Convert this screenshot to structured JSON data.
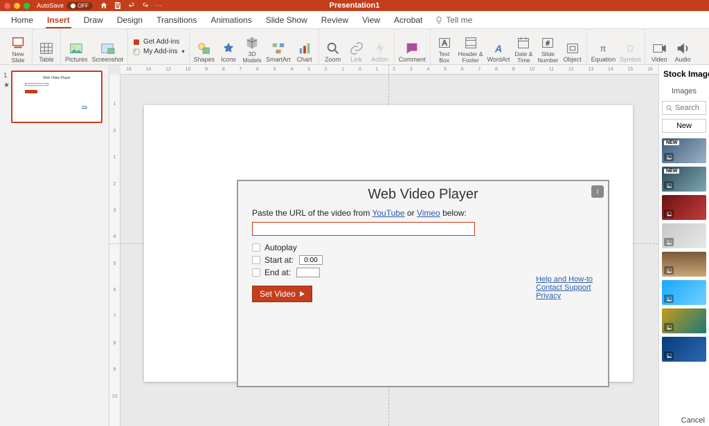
{
  "titlebar": {
    "autosave_label": "AutoSave",
    "autosave_state": "OFF",
    "doc_title": "Presentation1"
  },
  "tabs": {
    "items": [
      "Home",
      "Insert",
      "Draw",
      "Design",
      "Transitions",
      "Animations",
      "Slide Show",
      "Review",
      "View",
      "Acrobat"
    ],
    "active_index": 1,
    "tellme": "Tell me"
  },
  "ribbon": {
    "new_slide": "New\nSlide",
    "table": "Table",
    "pictures": "Pictures",
    "screenshot": "Screenshot",
    "get_addins": "Get Add-ins",
    "my_addins": "My Add-ins",
    "shapes": "Shapes",
    "icons": "Icons",
    "models": "3D\nModels",
    "smartart": "SmartArt",
    "chart": "Chart",
    "zoom": "Zoom",
    "link": "Link",
    "action": "Action",
    "comment": "Comment",
    "textbox": "Text\nBox",
    "header": "Header &\nFooter",
    "wordart": "WordArt",
    "datetime": "Date &\nTime",
    "slidenum": "Slide\nNumber",
    "object": "Object",
    "equation": "Equation",
    "symbol": "Symbol",
    "video": "Video",
    "audio": "Audio"
  },
  "thumbs": {
    "index": "1",
    "star": "★"
  },
  "wvp": {
    "title": "Web Video Player",
    "instr_pre": "Paste the URL of the video from ",
    "yt": "YouTube",
    "or": " or ",
    "vm": "Vimeo",
    "instr_post": " below:",
    "autoplay": "Autoplay",
    "start": "Start at:",
    "start_val": "0:00",
    "end": "End at:",
    "end_val": "",
    "set": "Set Video",
    "help1": "Help and How-to",
    "help2": "Contact Support",
    "help3": "Privacy"
  },
  "panel": {
    "title": "Stock Images",
    "sub": "Images",
    "search": "Search",
    "newbtn": "New",
    "cancel": "Cancel",
    "new_badge": "NEW",
    "tiles": [
      {
        "bg": "linear-gradient(135deg,#3a5a7a,#9db4c6)",
        "new": true
      },
      {
        "bg": "linear-gradient(135deg,#2b4a5a,#7fa8b0)",
        "new": true
      },
      {
        "bg": "linear-gradient(135deg,#6b1212,#c43c3c)",
        "new": false
      },
      {
        "bg": "linear-gradient(135deg,#c8c8c8,#e8e8e8)",
        "new": false
      },
      {
        "bg": "linear-gradient(180deg,#7a5a3a,#caa678)",
        "new": false
      },
      {
        "bg": "linear-gradient(135deg,#1aa7ff,#6fd0ff)",
        "new": false
      },
      {
        "bg": "linear-gradient(135deg,#c49a1a,#1a7a7a)",
        "new": false
      },
      {
        "bg": "linear-gradient(135deg,#0a3a7a,#2a6ab0)",
        "new": false
      }
    ]
  },
  "ruler": {
    "h": [
      "16",
      "14",
      "12",
      "10",
      "9",
      "8",
      "7",
      "6",
      "5",
      "4",
      "3",
      "2",
      "1",
      "0",
      "1",
      "2",
      "3",
      "4",
      "5",
      "6",
      "7",
      "8",
      "9",
      "10",
      "11",
      "12",
      "13",
      "14",
      "15",
      "16"
    ],
    "v": [
      "",
      "1",
      "0",
      "1",
      "2",
      "3",
      "4",
      "5",
      "6",
      "7",
      "8",
      "9",
      "10",
      ""
    ]
  }
}
